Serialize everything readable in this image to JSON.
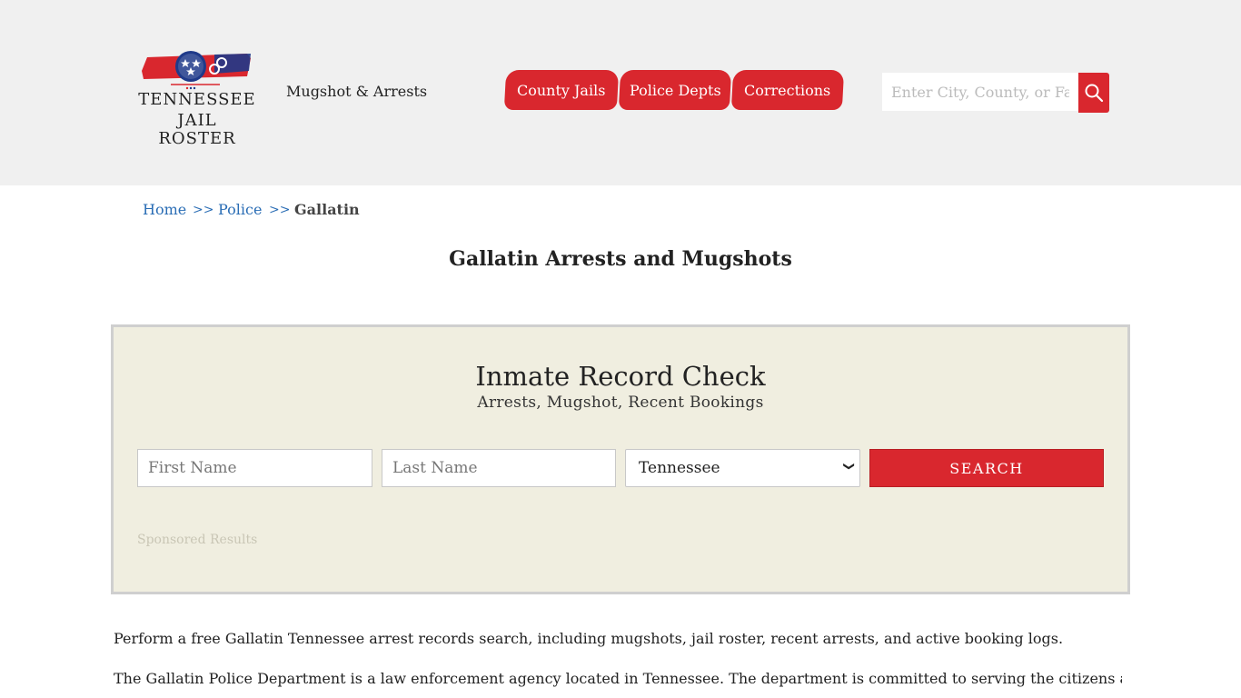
{
  "brand": {
    "logo_line1": "TENNESSEE",
    "logo_line2": "JAIL ROSTER",
    "tagline": "Mugshot & Arrests",
    "colors": {
      "red": "#d9272e",
      "blue": "#1f3a8a"
    }
  },
  "nav": {
    "items": [
      {
        "label": "County Jails"
      },
      {
        "label": "Police Depts"
      },
      {
        "label": "Corrections"
      }
    ]
  },
  "search": {
    "placeholder": "Enter City, County, or Facil",
    "icon": "search-icon"
  },
  "breadcrumb": {
    "home": "Home",
    "sep": ">>",
    "police": "Police",
    "current": "Gallatin"
  },
  "page": {
    "title": "Gallatin Arrests and Mugshots"
  },
  "record_check": {
    "title": "Inmate Record Check",
    "subtitle": "Arrests, Mugshot, Recent Bookings",
    "first_name_placeholder": "First Name",
    "last_name_placeholder": "Last Name",
    "state_selected": "Tennessee",
    "button_label": "SEARCH",
    "sponsored": "Sponsored Results"
  },
  "content": {
    "p1": "Perform a free Gallatin Tennessee arrest records search, including mugshots, jail roster, recent arrests, and active booking logs.",
    "p2": "The Gallatin Police Department is a law enforcement agency located in Tennessee. The department is committed to serving the citizens and"
  }
}
